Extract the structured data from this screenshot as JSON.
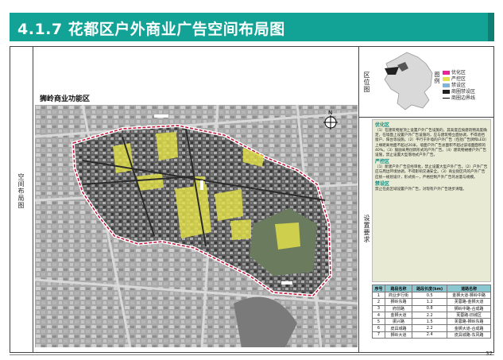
{
  "header": {
    "title": "4.1.7 花都区户外商业广告空间布局图"
  },
  "left_label": "空间布局图",
  "zone_title": "狮岭商业功能区",
  "location_label": "区位图",
  "legend_label": "图例",
  "setting_label": "设置要求",
  "legend": {
    "items": [
      {
        "label": "优化区",
        "color": "#e8259a"
      },
      {
        "label": "严控区",
        "color": "#e3e24a"
      },
      {
        "label": "禁设区",
        "color": "#7fb3d9"
      },
      {
        "label": "商圈禁设区",
        "color": "#1f1f1f"
      },
      {
        "label": "商圈边界线",
        "color": "#000000"
      }
    ]
  },
  "requirements": {
    "sections": [
      {
        "title": "优化区",
        "text": "（1）在建筑物屋顶上设置户外广告设施的，其高度应按建筑物高度确定，在墙面上设置户外广告设施的，应与建筑物立面协调，不得遮挡窗户、阳台等设施。（2）平行于外墙的户外广告（包括广告牌和LED）上缘距离地面不超过20米，墙面户外广告总面积不超过该墙面面积的40%。（3）鼓励采用创新形式的户外广告。（4）建筑物裙楼户外广告设施，禁止设置大型落地式户外广告。"
      },
      {
        "title": "严控区",
        "text": "（1）新建户外广告应经审批，禁止设置大型户外广告。（2）户外广告应与周边环境协调，不得影响交通安全。（3）商业街区内的户外广告应统一规划设计，形式统一，严格控制户外广告的总量与规模。"
      },
      {
        "title": "禁设区",
        "text": "禁止在此区域设置户外广告，对现有户外广告逐步清理。"
      }
    ]
  },
  "table": {
    "headers": [
      "序号",
      "路段名称",
      "路段长度(km)",
      "道路名称"
    ],
    "rows": [
      [
        "1",
        "商业步行街",
        "0.5",
        "金狮大道-狮岭中路"
      ],
      [
        "2",
        "狮岭东路",
        "1.2",
        "芙蓉路-金狮大道"
      ],
      [
        "3",
        "府前路",
        "0.8",
        "狮岭中路-合成路"
      ],
      [
        "4",
        "金狮大道",
        "2.2",
        "芙蓉路-旧城区"
      ],
      [
        "5",
        "振兴路",
        "1.5",
        "芙蓉路-狮岭东路"
      ],
      [
        "6",
        "皮具城路",
        "2.2",
        "金狮大道-合成路"
      ],
      [
        "7",
        "狮岭大道",
        "2.4",
        "皮具城路-东风路"
      ]
    ]
  },
  "page_number": "32"
}
